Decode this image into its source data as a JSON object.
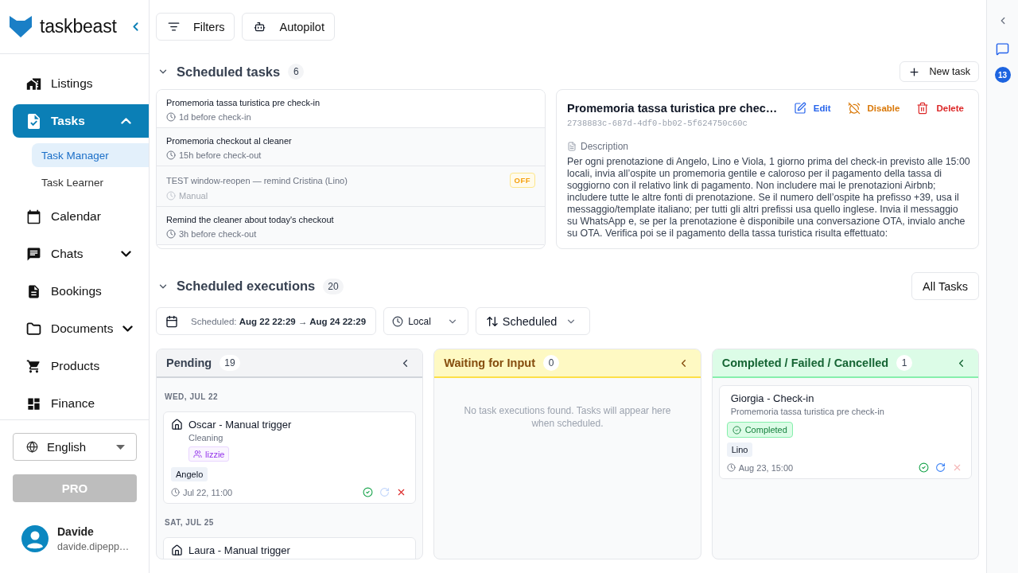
{
  "sidebar": {
    "brand": "taskbeast",
    "nav": [
      {
        "label": "Listings",
        "selected": false
      },
      {
        "label": "Tasks",
        "selected": true,
        "expanded": true,
        "children": [
          {
            "label": "Task Manager",
            "selected": true
          },
          {
            "label": "Task Learner",
            "selected": false
          }
        ]
      },
      {
        "label": "Calendar",
        "selected": false
      },
      {
        "label": "Chats",
        "selected": false,
        "expanded": false
      },
      {
        "label": "Bookings",
        "selected": false
      },
      {
        "label": "Documents",
        "selected": false,
        "expanded": false
      },
      {
        "label": "Products",
        "selected": false
      },
      {
        "label": "Finance",
        "selected": false
      }
    ],
    "language": "English",
    "pro_button": "PRO",
    "user": {
      "name": "Davide",
      "email": "davide.dipepp…"
    }
  },
  "toolbar": {
    "buttons": [
      "Filters",
      "Autopilot"
    ]
  },
  "scheduled_tasks": {
    "title": "Scheduled tasks",
    "count": "6",
    "expanded": true,
    "new_button": "New task",
    "tasks": [
      {
        "name": "Promemoria tassa turistica pre check-in",
        "trigger": "1d before check-in",
        "selected": true,
        "enabled": true
      },
      {
        "name": "Promemoria checkout al cleaner",
        "trigger": "15h before check-out",
        "selected": false,
        "enabled": true
      },
      {
        "name": "TEST window-reopen — remind Cristina (Lino)",
        "trigger": "Manual",
        "selected": false,
        "enabled": false,
        "badge": "OFF"
      },
      {
        "name": "Remind the cleaner about today's checkout",
        "trigger": "3h before check-out",
        "selected": false,
        "enabled": true
      }
    ]
  },
  "task_detail": {
    "title": "Promemoria tassa turistica pre chec…",
    "id": "2738883c-687d-4df0-bb02-5f624750c60c",
    "actions": [
      {
        "kind": "edit",
        "label": "Edit"
      },
      {
        "kind": "disable",
        "label": "Disable"
      },
      {
        "kind": "delete",
        "label": "Delete"
      }
    ],
    "description_label": "Description",
    "description": "Per ogni prenotazione di Angelo, Lino e Viola, 1 giorno prima del check-in previsto alle 15:00 locali, invia all’ospite un promemoria gentile e caloroso per il pagamento della tassa di soggiorno con il relativo link di pagamento. Non includere mai le prenotazioni Airbnb; includere tutte le altre fonti di prenotazione. Se il numero dell’ospite ha prefisso +39, usa il messaggio/template italiano; per tutti gli altri prefissi usa quello inglese. Invia il messaggio su WhatsApp e, se per la prenotazione è disponibile una conversazione OTA, invialo anche su OTA. Verifica poi se il pagamento della tassa turistica risulta effettuato:"
  },
  "executions": {
    "title": "Scheduled executions",
    "count": "20",
    "expanded": true,
    "all_button": "All Tasks",
    "range_label": "Scheduled:",
    "range_value": "Aug 22 22:29 → Aug 24 22:29",
    "timezone": "Local",
    "sort": "Scheduled",
    "columns": [
      {
        "kind": "pending",
        "title": "Pending",
        "count": "19",
        "groups": [
          {
            "date": "WED, JUL 22",
            "cards": [
              {
                "kind": "listing",
                "title": "Oscar - Manual trigger",
                "subtitle": "Cleaning",
                "assignee": "lizzie",
                "guest": "Angelo",
                "time": "Jul 22, 11:00",
                "actions": [
                  {
                    "kind": "complete",
                    "disabled": false
                  },
                  {
                    "kind": "retry",
                    "disabled": true
                  },
                  {
                    "kind": "cancel",
                    "disabled": false
                  }
                ]
              }
            ]
          },
          {
            "date": "SAT, JUL 25",
            "cards": [
              {
                "kind": "listing",
                "title": "Laura - Manual trigger"
              }
            ]
          }
        ]
      },
      {
        "kind": "waiting",
        "title": "Waiting for Input",
        "count": "0",
        "empty_text": "No task executions found. Tasks will appear here when scheduled."
      },
      {
        "kind": "done",
        "title": "Completed / Failed / Cancelled",
        "count": "1",
        "cards": [
          {
            "kind": "task",
            "title": "Giorgia - Check-in",
            "subtitle": "Promemoria tassa turistica pre check-in",
            "status": {
              "kind": "completed",
              "label": "Completed"
            },
            "guest": "Lino",
            "time": "Aug 23, 15:00",
            "actions": [
              {
                "kind": "complete",
                "disabled": false
              },
              {
                "kind": "retry",
                "disabled": false
              },
              {
                "kind": "cancel",
                "disabled": true
              }
            ]
          }
        ]
      }
    ]
  },
  "right_rail": {
    "chat_badge": "13"
  }
}
